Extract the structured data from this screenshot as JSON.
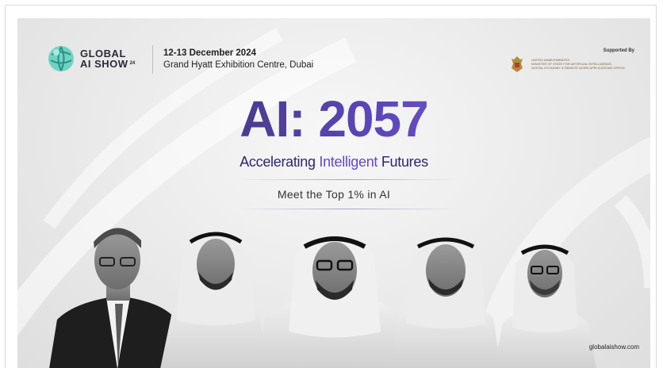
{
  "brand": {
    "name_line1": "GLOBAL",
    "name_line2": "AI SHOW",
    "edition": "24",
    "logo_color": "#6fd3c2"
  },
  "event": {
    "date": "12-13 December 2024",
    "venue": "Grand Hyatt Exhibition Centre, Dubai"
  },
  "sponsor": {
    "label": "Supported By",
    "lines": [
      "UNITED ARAB EMIRATES",
      "MINISTER OF STATE FOR ARTIFICIAL INTELLIGENCE,",
      "DIGITAL ECONOMY & REMOTE WORK APPLICATIONS OFFICE"
    ]
  },
  "headline": "AI: 2057",
  "subheadline": {
    "part1": "Accelerating ",
    "accent": "Intelligent",
    "part2": " Futures"
  },
  "tagline": "Meet the Top 1% in AI",
  "website": "globalaishow.com",
  "colors": {
    "headline_start": "#2b2b44",
    "headline_end": "#8a66e6",
    "accent": "#6448c8"
  },
  "speakers": [
    {
      "icon": "speaker-portrait-suit"
    },
    {
      "icon": "speaker-portrait-ghutra"
    },
    {
      "icon": "speaker-portrait-ghutra-glasses"
    },
    {
      "icon": "speaker-portrait-ghutra"
    },
    {
      "icon": "speaker-portrait-ghutra-glasses"
    }
  ]
}
